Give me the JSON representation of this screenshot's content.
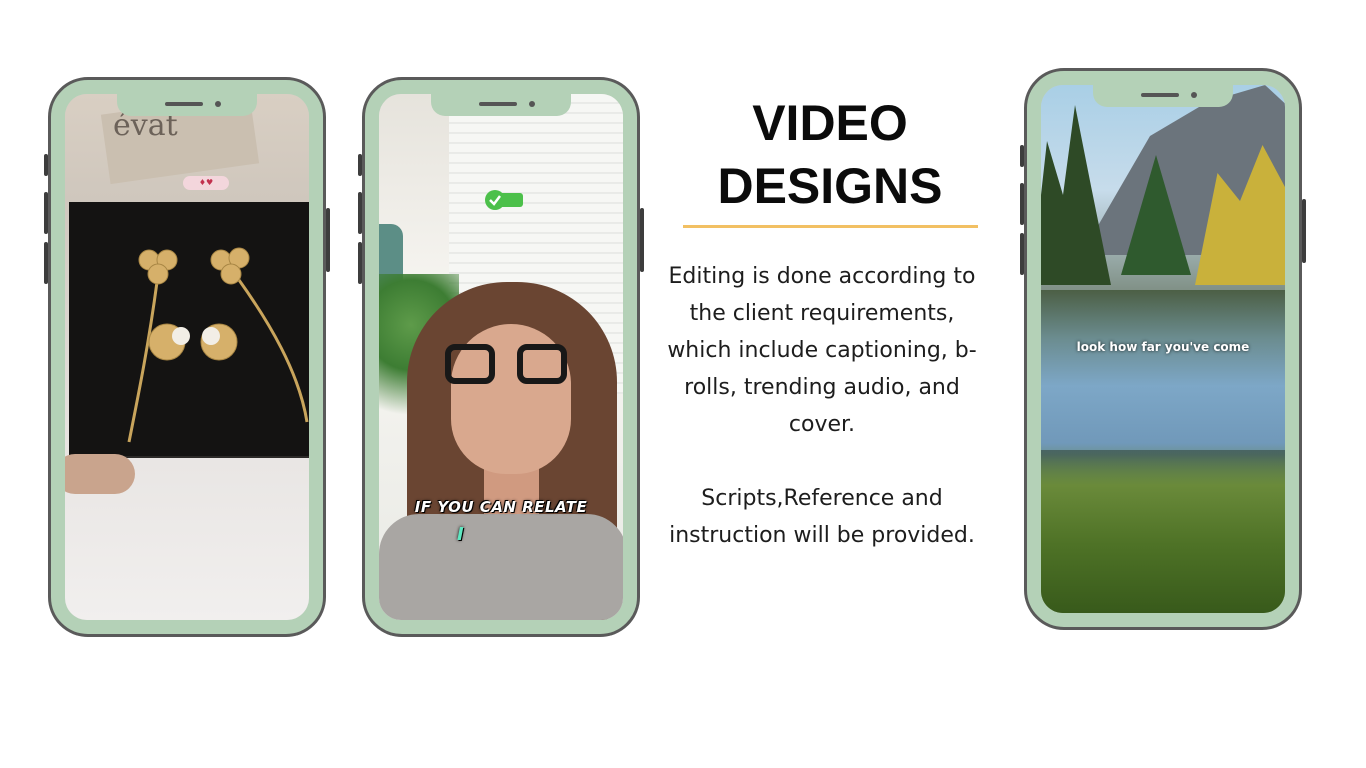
{
  "title_line1": "VIDEO",
  "title_line2": "DESIGNS",
  "description": "Editing is done according to the client requirements, which include captioning, b-rolls, trending audio, and cover.",
  "note": "Scripts,Reference and instruction will be provided.",
  "phone1": {
    "brand": "évat"
  },
  "phone2": {
    "caption": "IF YOU CAN RELATE",
    "caption_word": "I"
  },
  "phone3": {
    "caption": "look how far you've come"
  },
  "colors": {
    "phone_frame": "#b4d1b7",
    "accent_rule": "#f2c063",
    "title": "#0b0b0b"
  }
}
